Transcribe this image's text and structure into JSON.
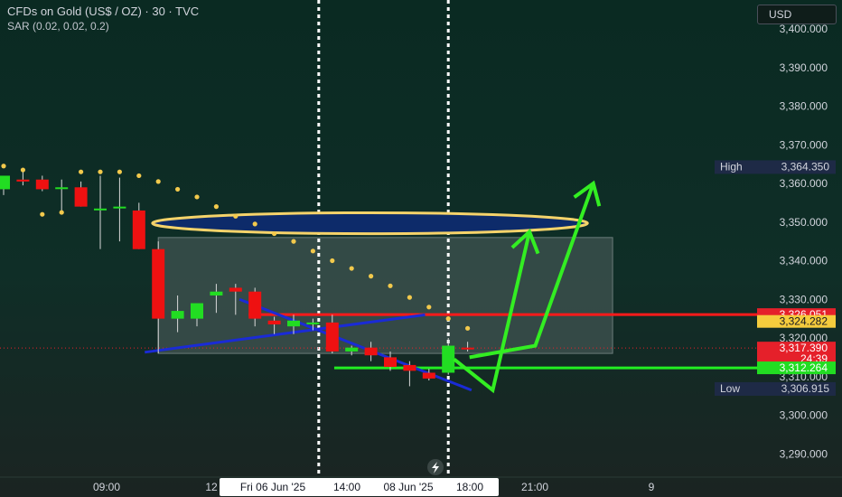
{
  "header": {
    "title": "CFDs on Gold (US$ / OZ) · 30 · TVC",
    "indicator": "SAR (0.02, 0.02, 0.2)",
    "currency": "USD"
  },
  "colors": {
    "background": "#0e2b24",
    "up": "#22dd22",
    "down": "#ee1111",
    "sar": "#f2c94c",
    "trendline": "#1a2bd6",
    "resistance": "#ff1a1a",
    "support": "#22ee22",
    "forecast": "#33ee22",
    "zone": "#4b5c5a",
    "ellipse_fill": "#0d2b6a",
    "ellipse_stroke": "#f5d36a"
  },
  "chart_data": {
    "type": "candlestick",
    "y_axis": {
      "min": 3288,
      "max": 3407,
      "ticks": [
        "3,290.000",
        "3,300.000",
        "3,310.000",
        "3,320.000",
        "3,330.000",
        "3,340.000",
        "3,350.000",
        "3,360.000",
        "3,370.000",
        "3,380.000",
        "3,390.000",
        "3,400.000"
      ]
    },
    "x_axis": {
      "ticks": [
        "09:00",
        "12",
        "Fri 06 Jun '25",
        "14:00",
        "08 Jun '25",
        "18:00",
        "21:00",
        "9"
      ]
    },
    "candles": [
      {
        "o": 3358.5,
        "h": 3362,
        "l": 3357,
        "c": 3362
      },
      {
        "o": 3361,
        "h": 3363,
        "l": 3359.5,
        "c": 3360.5
      },
      {
        "o": 3361,
        "h": 3362,
        "l": 3358,
        "c": 3358.5
      },
      {
        "o": 3359,
        "h": 3361,
        "l": 3353,
        "c": 3359
      },
      {
        "o": 3359,
        "h": 3360.5,
        "l": 3354,
        "c": 3354
      },
      {
        "o": 3353.5,
        "h": 3362,
        "l": 3343,
        "c": 3353.5
      },
      {
        "o": 3354,
        "h": 3361.5,
        "l": 3345,
        "c": 3354
      },
      {
        "o": 3353,
        "h": 3355,
        "l": 3343,
        "c": 3343
      },
      {
        "o": 3343,
        "h": 3345,
        "l": 3316,
        "c": 3325
      },
      {
        "o": 3325,
        "h": 3331,
        "l": 3321.5,
        "c": 3327
      },
      {
        "o": 3325,
        "h": 3328.5,
        "l": 3323,
        "c": 3329
      },
      {
        "o": 3331,
        "h": 3334,
        "l": 3326.5,
        "c": 3332
      },
      {
        "o": 3333,
        "h": 3334,
        "l": 3326,
        "c": 3332
      },
      {
        "o": 3332,
        "h": 3333,
        "l": 3323,
        "c": 3325
      },
      {
        "o": 3324.5,
        "h": 3325.5,
        "l": 3321,
        "c": 3323.5
      },
      {
        "o": 3323,
        "h": 3326,
        "l": 3321,
        "c": 3324.5
      },
      {
        "o": 3324,
        "h": 3325,
        "l": 3322,
        "c": 3324
      },
      {
        "o": 3324,
        "h": 3326,
        "l": 3316,
        "c": 3316.5
      },
      {
        "o": 3316.5,
        "h": 3318,
        "l": 3315.5,
        "c": 3317.5
      },
      {
        "o": 3317.5,
        "h": 3319,
        "l": 3314,
        "c": 3315.5
      },
      {
        "o": 3315,
        "h": 3316.5,
        "l": 3311.5,
        "c": 3312.5
      },
      {
        "o": 3313,
        "h": 3314,
        "l": 3307.5,
        "c": 3311.5
      },
      {
        "o": 3311,
        "h": 3312,
        "l": 3309,
        "c": 3309.5
      },
      {
        "o": 3311,
        "h": 3320,
        "l": 3310.5,
        "c": 3318
      },
      {
        "o": 3317.5,
        "h": 3319,
        "l": 3316.5,
        "c": 3317.4
      }
    ],
    "sar": [
      3364.5,
      3363.5,
      3352,
      3352.5,
      3363,
      3363,
      3363,
      3362,
      3360.5,
      3358.5,
      3356.5,
      3354,
      3351.5,
      3349.5,
      3347,
      3345,
      3342.5,
      3340,
      3338,
      3336,
      3333.5,
      3330.5,
      3328,
      3325,
      3322.5
    ],
    "series": [
      {
        "name": "High",
        "value": "3,364.350"
      },
      {
        "name": "Low",
        "value": "3,306.915"
      }
    ],
    "price_labels": [
      {
        "value": "3,326.051",
        "y": 3326.051,
        "color": "#e5202a"
      },
      {
        "value": "3,324.282",
        "y": 3324.282,
        "color": "#f5cc3d"
      },
      {
        "value": "3,317.390",
        "y": 3317.39,
        "sub": "24:39",
        "color": "#e5202a"
      },
      {
        "value": "3,312.264",
        "y": 3312.264,
        "color": "#22dd22"
      }
    ],
    "levels": {
      "resistance": 3326.051,
      "support": 3312.264,
      "last": 3317.39
    },
    "zone": {
      "from": 8,
      "to": 31.5,
      "top": 3346,
      "bottom": 3316
    },
    "ellipse": {
      "from": 7.7,
      "to": 30.2,
      "price": 3349.7,
      "half_height": 2.7
    },
    "trend_lines": [
      {
        "x1": 7.3,
        "p1": 3316.3,
        "x2": 21.8,
        "p2": 3326
      },
      {
        "x1": 12.2,
        "p1": 3330,
        "x2": 24.2,
        "p2": 3306.5
      }
    ],
    "forecast": [
      {
        "i": 23.3,
        "p": 3314.5
      },
      {
        "i": 25.3,
        "p": 3306.5
      },
      {
        "i": 27.2,
        "p": 3347.5
      },
      {
        "i": 28.1,
        "p": 3343
      }
    ],
    "forecast2": [
      {
        "i": 24.1,
        "p": 3315
      },
      {
        "i": 27.5,
        "p": 3318
      },
      {
        "i": 30.5,
        "p": 3360
      }
    ],
    "sessions": [
      16.3,
      23
    ]
  }
}
